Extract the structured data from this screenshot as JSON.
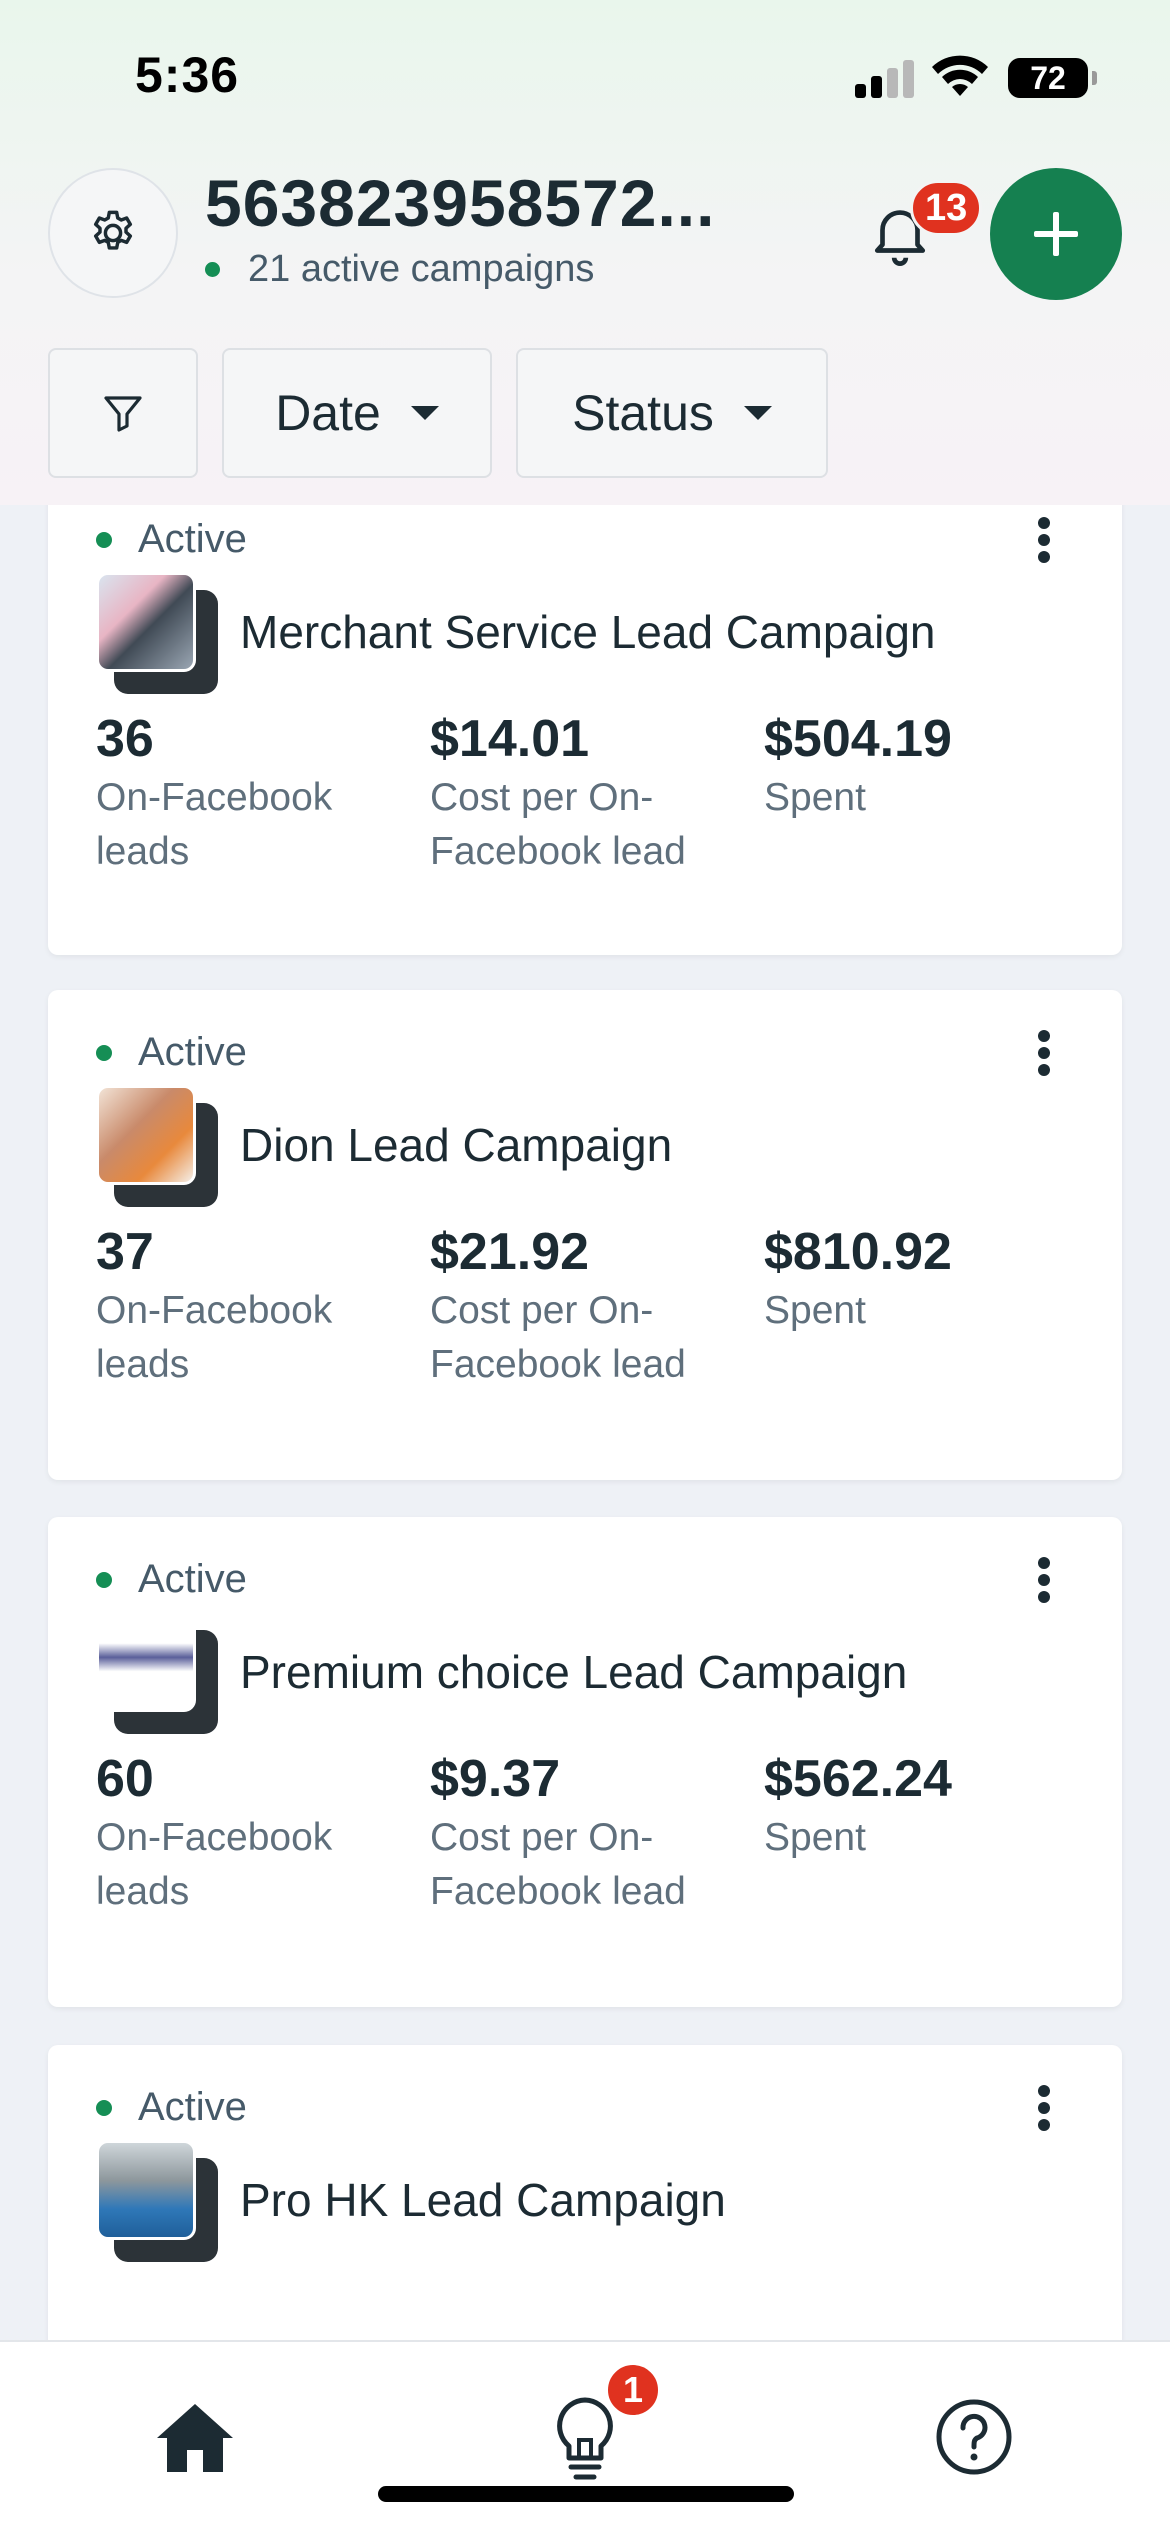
{
  "status_bar": {
    "time": "5:36",
    "battery": "72"
  },
  "header": {
    "account_name": "563823958572...",
    "active_campaigns": "21 active campaigns",
    "notification_count": "13"
  },
  "filters": {
    "date_label": "Date",
    "status_label": "Status"
  },
  "campaigns": [
    {
      "status": "Active",
      "name": "Merchant Service Lead Campaign",
      "leads_value": "36",
      "leads_label_1": "On-Facebook",
      "leads_label_2": "leads",
      "cost_value": "$14.01",
      "cost_label_1": "Cost per On-",
      "cost_label_2": "Facebook lead",
      "spent_value": "$504.19",
      "spent_label": "Spent"
    },
    {
      "status": "Active",
      "name": "Dion Lead Campaign",
      "leads_value": "37",
      "leads_label_1": "On-Facebook",
      "leads_label_2": "leads",
      "cost_value": "$21.92",
      "cost_label_1": "Cost per On-",
      "cost_label_2": "Facebook lead",
      "spent_value": "$810.92",
      "spent_label": "Spent"
    },
    {
      "status": "Active",
      "name": "Premium choice Lead Campaign",
      "leads_value": "60",
      "leads_label_1": "On-Facebook",
      "leads_label_2": "leads",
      "cost_value": "$9.37",
      "cost_label_1": "Cost per On-",
      "cost_label_2": "Facebook lead",
      "spent_value": "$562.24",
      "spent_label": "Spent"
    },
    {
      "status": "Active",
      "name": "Pro HK Lead Campaign"
    }
  ],
  "bottom_nav": {
    "ideas_badge": "1"
  },
  "colors": {
    "accent_green": "#158050",
    "badge_red": "#e0321f",
    "text_dark": "#1c2b33"
  }
}
